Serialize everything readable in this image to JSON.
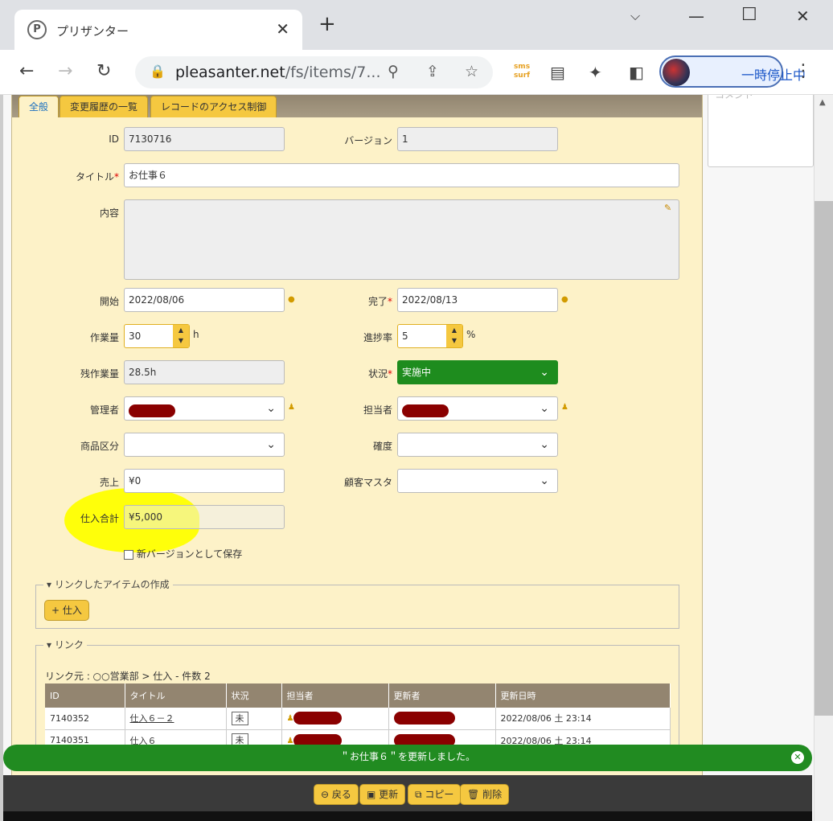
{
  "browser": {
    "tab_title": "プリザンター",
    "tab_close": "✕",
    "new_tab": "+",
    "url_host": "pleasanter.net",
    "url_path": "/fs/items/7...",
    "profile_label": "一時停止中",
    "ext_label_top": "sms",
    "ext_label_bottom": "surf"
  },
  "tabs": [
    {
      "label": "全般",
      "active": true
    },
    {
      "label": "変更履歴の一覧",
      "active": false
    },
    {
      "label": "レコードのアクセス制御",
      "active": false
    }
  ],
  "form": {
    "id": {
      "label": "ID",
      "value": "7130716"
    },
    "version": {
      "label": "バージョン",
      "value": "1"
    },
    "title": {
      "label": "タイトル",
      "value": "お仕事６"
    },
    "content": {
      "label": "内容",
      "value": ""
    },
    "start": {
      "label": "開始",
      "value": "2022/08/06"
    },
    "end": {
      "label": "完了",
      "value": "2022/08/13"
    },
    "work": {
      "label": "作業量",
      "value": "30",
      "unit": "h"
    },
    "progress": {
      "label": "進捗率",
      "value": "5",
      "unit": "%"
    },
    "remaining": {
      "label": "残作業量",
      "value": "28.5h"
    },
    "status": {
      "label": "状況",
      "value": "実施中",
      "color": "#1e8c1e"
    },
    "manager": {
      "label": "管理者"
    },
    "owner": {
      "label": "担当者"
    },
    "product": {
      "label": "商品区分",
      "value": ""
    },
    "certainty": {
      "label": "確度",
      "value": ""
    },
    "sales": {
      "label": "売上",
      "value": "¥0"
    },
    "customer": {
      "label": "顧客マスタ",
      "value": ""
    },
    "purchase_total": {
      "label": "仕入合計",
      "value": "¥5,000"
    },
    "save_as_version": "新バージョンとして保存",
    "required_mark": "*"
  },
  "linked_create": {
    "legend": "リンクしたアイテムの作成",
    "button": "+ 仕入"
  },
  "links": {
    "legend": "リンク",
    "caption": "リンク元 : ○○営業部 > 仕入 - 件数 2",
    "columns": [
      "ID",
      "タイトル",
      "状況",
      "担当者",
      "更新者",
      "更新日時"
    ],
    "rows": [
      {
        "id": "7140352",
        "title": "仕入６－２",
        "status": "未",
        "updated": "2022/08/06 土 23:14"
      },
      {
        "id": "7140351",
        "title": "仕入６",
        "status": "未",
        "updated": "2022/08/06 土 23:14"
      }
    ]
  },
  "notice": "＂お仕事６＂を更新しました。",
  "footer_buttons": [
    "戻る",
    "更新",
    "コピー",
    "削除"
  ],
  "side_comment_placeholder": "コメント",
  "colors": {
    "accent": "#f5c840",
    "panel": "#fdf2c8",
    "banner": "#218b21",
    "highlight": "#ffff00"
  }
}
